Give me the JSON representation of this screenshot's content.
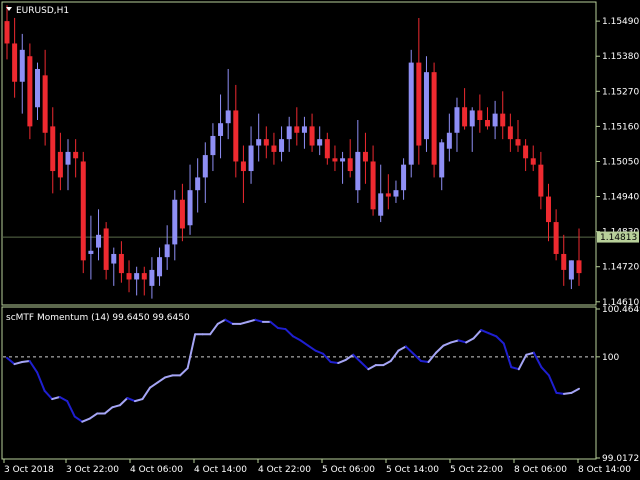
{
  "colors": {
    "background": "#000000",
    "frame": "#b8d09a",
    "bull": "#8f8ff5",
    "bear": "#ee2a30",
    "bid_line": "#5a6b4a",
    "bid_tag": "#b8d09a",
    "momentum_dark": "#1f1fd0",
    "momentum_light": "#a5a5f5",
    "level_line": "#cfcfcf",
    "text": "#ffffff"
  },
  "window": {
    "symbol_title": "EURUSD,H1",
    "indicator_title": "scMTF Momentum (14) 99.6450 99.6450"
  },
  "chart_data": [
    {
      "type": "candlestick",
      "title": "EURUSD,H1",
      "yticks": [
        "1.15490",
        "1.15380",
        "1.15270",
        "1.15160",
        "1.15050",
        "1.14940",
        "1.14830",
        "1.14720",
        "1.14610"
      ],
      "ylim": [
        1.146,
        1.1555
      ],
      "bid": 1.14813,
      "bid_label": "1.14813",
      "candles": [
        [
          1.1549,
          1.1554,
          1.1537,
          1.1542
        ],
        [
          1.1542,
          1.155,
          1.1525,
          1.153
        ],
        [
          1.153,
          1.1545,
          1.152,
          1.154
        ],
        [
          1.1538,
          1.1542,
          1.1512,
          1.1516
        ],
        [
          1.1522,
          1.1536,
          1.1518,
          1.1534
        ],
        [
          1.1532,
          1.154,
          1.151,
          1.1514
        ],
        [
          1.1516,
          1.1522,
          1.1495,
          1.1502
        ],
        [
          1.1508,
          1.1514,
          1.1496,
          1.15
        ],
        [
          1.1504,
          1.1512,
          1.1496,
          1.1508
        ],
        [
          1.1508,
          1.1512,
          1.15,
          1.1506
        ],
        [
          1.1505,
          1.1508,
          1.147,
          1.1474
        ],
        [
          1.1476,
          1.1488,
          1.1468,
          1.1477
        ],
        [
          1.1478,
          1.149,
          1.1474,
          1.1482
        ],
        [
          1.1484,
          1.1486,
          1.1468,
          1.1471
        ],
        [
          1.1473,
          1.1478,
          1.1466,
          1.1476
        ],
        [
          1.1476,
          1.148,
          1.1467,
          1.147
        ],
        [
          1.147,
          1.1474,
          1.1464,
          1.1468
        ],
        [
          1.1468,
          1.1472,
          1.1463,
          1.147
        ],
        [
          1.147,
          1.1472,
          1.1463,
          1.1468
        ],
        [
          1.1466,
          1.1475,
          1.1462,
          1.1471
        ],
        [
          1.1469,
          1.1478,
          1.1466,
          1.1475
        ],
        [
          1.1475,
          1.1485,
          1.1471,
          1.1479
        ],
        [
          1.1479,
          1.1496,
          1.1474,
          1.1493
        ],
        [
          1.1493,
          1.1498,
          1.148,
          1.1484
        ],
        [
          1.1485,
          1.1504,
          1.1482,
          1.1496
        ],
        [
          1.1496,
          1.1506,
          1.1489,
          1.15
        ],
        [
          1.15,
          1.1511,
          1.1492,
          1.1507
        ],
        [
          1.1507,
          1.1517,
          1.1502,
          1.1513
        ],
        [
          1.1513,
          1.1526,
          1.1506,
          1.1517
        ],
        [
          1.1517,
          1.1534,
          1.1512,
          1.1521
        ],
        [
          1.1521,
          1.1529,
          1.15,
          1.1505
        ],
        [
          1.1505,
          1.151,
          1.1492,
          1.1502
        ],
        [
          1.1502,
          1.1516,
          1.1498,
          1.151
        ],
        [
          1.151,
          1.152,
          1.1505,
          1.1512
        ],
        [
          1.1512,
          1.1516,
          1.1506,
          1.151
        ],
        [
          1.151,
          1.1514,
          1.1504,
          1.1508
        ],
        [
          1.1508,
          1.1516,
          1.1505,
          1.1512
        ],
        [
          1.1512,
          1.1519,
          1.1508,
          1.1516
        ],
        [
          1.1516,
          1.1522,
          1.151,
          1.1514
        ],
        [
          1.1514,
          1.1519,
          1.1509,
          1.1516
        ],
        [
          1.1516,
          1.152,
          1.1508,
          1.151
        ],
        [
          1.151,
          1.1516,
          1.1507,
          1.1512
        ],
        [
          1.1512,
          1.1514,
          1.1504,
          1.1506
        ],
        [
          1.1506,
          1.151,
          1.1502,
          1.1505
        ],
        [
          1.1505,
          1.1508,
          1.1498,
          1.1506
        ],
        [
          1.1506,
          1.1512,
          1.15,
          1.1502
        ],
        [
          1.1496,
          1.1518,
          1.1492,
          1.1508
        ],
        [
          1.1508,
          1.1514,
          1.1498,
          1.1505
        ],
        [
          1.1505,
          1.151,
          1.1488,
          1.149
        ],
        [
          1.1488,
          1.1504,
          1.1486,
          1.1495
        ],
        [
          1.1495,
          1.1501,
          1.149,
          1.1494
        ],
        [
          1.1494,
          1.1499,
          1.1492,
          1.1496
        ],
        [
          1.1496,
          1.1506,
          1.1493,
          1.1504
        ],
        [
          1.1504,
          1.154,
          1.15,
          1.1536
        ],
        [
          1.1536,
          1.155,
          1.1504,
          1.151
        ],
        [
          1.1512,
          1.1538,
          1.1508,
          1.1533
        ],
        [
          1.1533,
          1.1536,
          1.15,
          1.1504
        ],
        [
          1.15,
          1.1512,
          1.1496,
          1.1511
        ],
        [
          1.1509,
          1.152,
          1.1505,
          1.1514
        ],
        [
          1.1514,
          1.1525,
          1.1508,
          1.1522
        ],
        [
          1.1522,
          1.1528,
          1.1515,
          1.1516
        ],
        [
          1.1516,
          1.1522,
          1.1508,
          1.1521
        ],
        [
          1.1521,
          1.1526,
          1.1514,
          1.1518
        ],
        [
          1.1518,
          1.1522,
          1.1515,
          1.1516
        ],
        [
          1.1516,
          1.1524,
          1.1512,
          1.152
        ],
        [
          1.152,
          1.1527,
          1.1512,
          1.1516
        ],
        [
          1.1516,
          1.152,
          1.1508,
          1.1512
        ],
        [
          1.1512,
          1.1518,
          1.1508,
          1.151
        ],
        [
          1.151,
          1.1512,
          1.1502,
          1.1506
        ],
        [
          1.1506,
          1.151,
          1.1502,
          1.1504
        ],
        [
          1.1504,
          1.1508,
          1.149,
          1.1494
        ],
        [
          1.1494,
          1.1498,
          1.148,
          1.1486
        ],
        [
          1.1486,
          1.149,
          1.1474,
          1.1476
        ],
        [
          1.1476,
          1.1482,
          1.1466,
          1.1471
        ],
        [
          1.1468,
          1.1474,
          1.1465,
          1.1474
        ],
        [
          1.1474,
          1.1484,
          1.1466,
          1.147
        ]
      ]
    },
    {
      "type": "line",
      "title": "scMTF Momentum (14) 99.6450 99.6450",
      "yticks": [
        "100.4649",
        "100",
        "99.0172"
      ],
      "ylim": [
        99.0172,
        100.4649
      ],
      "level": 100,
      "xticks": [
        "3 Oct 2018",
        "3 Oct 22:00",
        "4 Oct 06:00",
        "4 Oct 14:00",
        "4 Oct 22:00",
        "5 Oct 06:00",
        "5 Oct 14:00",
        "5 Oct 22:00",
        "8 Oct 06:00",
        "8 Oct 14:00"
      ],
      "values": [
        99.99,
        99.93,
        99.95,
        99.96,
        99.85,
        99.67,
        99.59,
        99.61,
        99.57,
        99.42,
        99.37,
        99.4,
        99.45,
        99.45,
        99.51,
        99.53,
        99.6,
        99.57,
        99.59,
        99.7,
        99.75,
        99.8,
        99.82,
        99.82,
        99.89,
        100.22,
        100.22,
        100.22,
        100.32,
        100.36,
        100.32,
        100.32,
        100.34,
        100.36,
        100.34,
        100.34,
        100.28,
        100.27,
        100.2,
        100.16,
        100.11,
        100.06,
        100.03,
        99.95,
        99.94,
        99.97,
        100.02,
        99.95,
        99.88,
        99.92,
        99.92,
        99.96,
        100.06,
        100.1,
        100.03,
        99.96,
        99.95,
        100.04,
        100.11,
        100.14,
        100.16,
        100.14,
        100.18,
        100.26,
        100.23,
        100.2,
        100.13,
        99.9,
        99.88,
        100.02,
        100.04,
        99.9,
        99.82,
        99.65,
        99.64,
        99.65,
        99.69
      ]
    }
  ]
}
